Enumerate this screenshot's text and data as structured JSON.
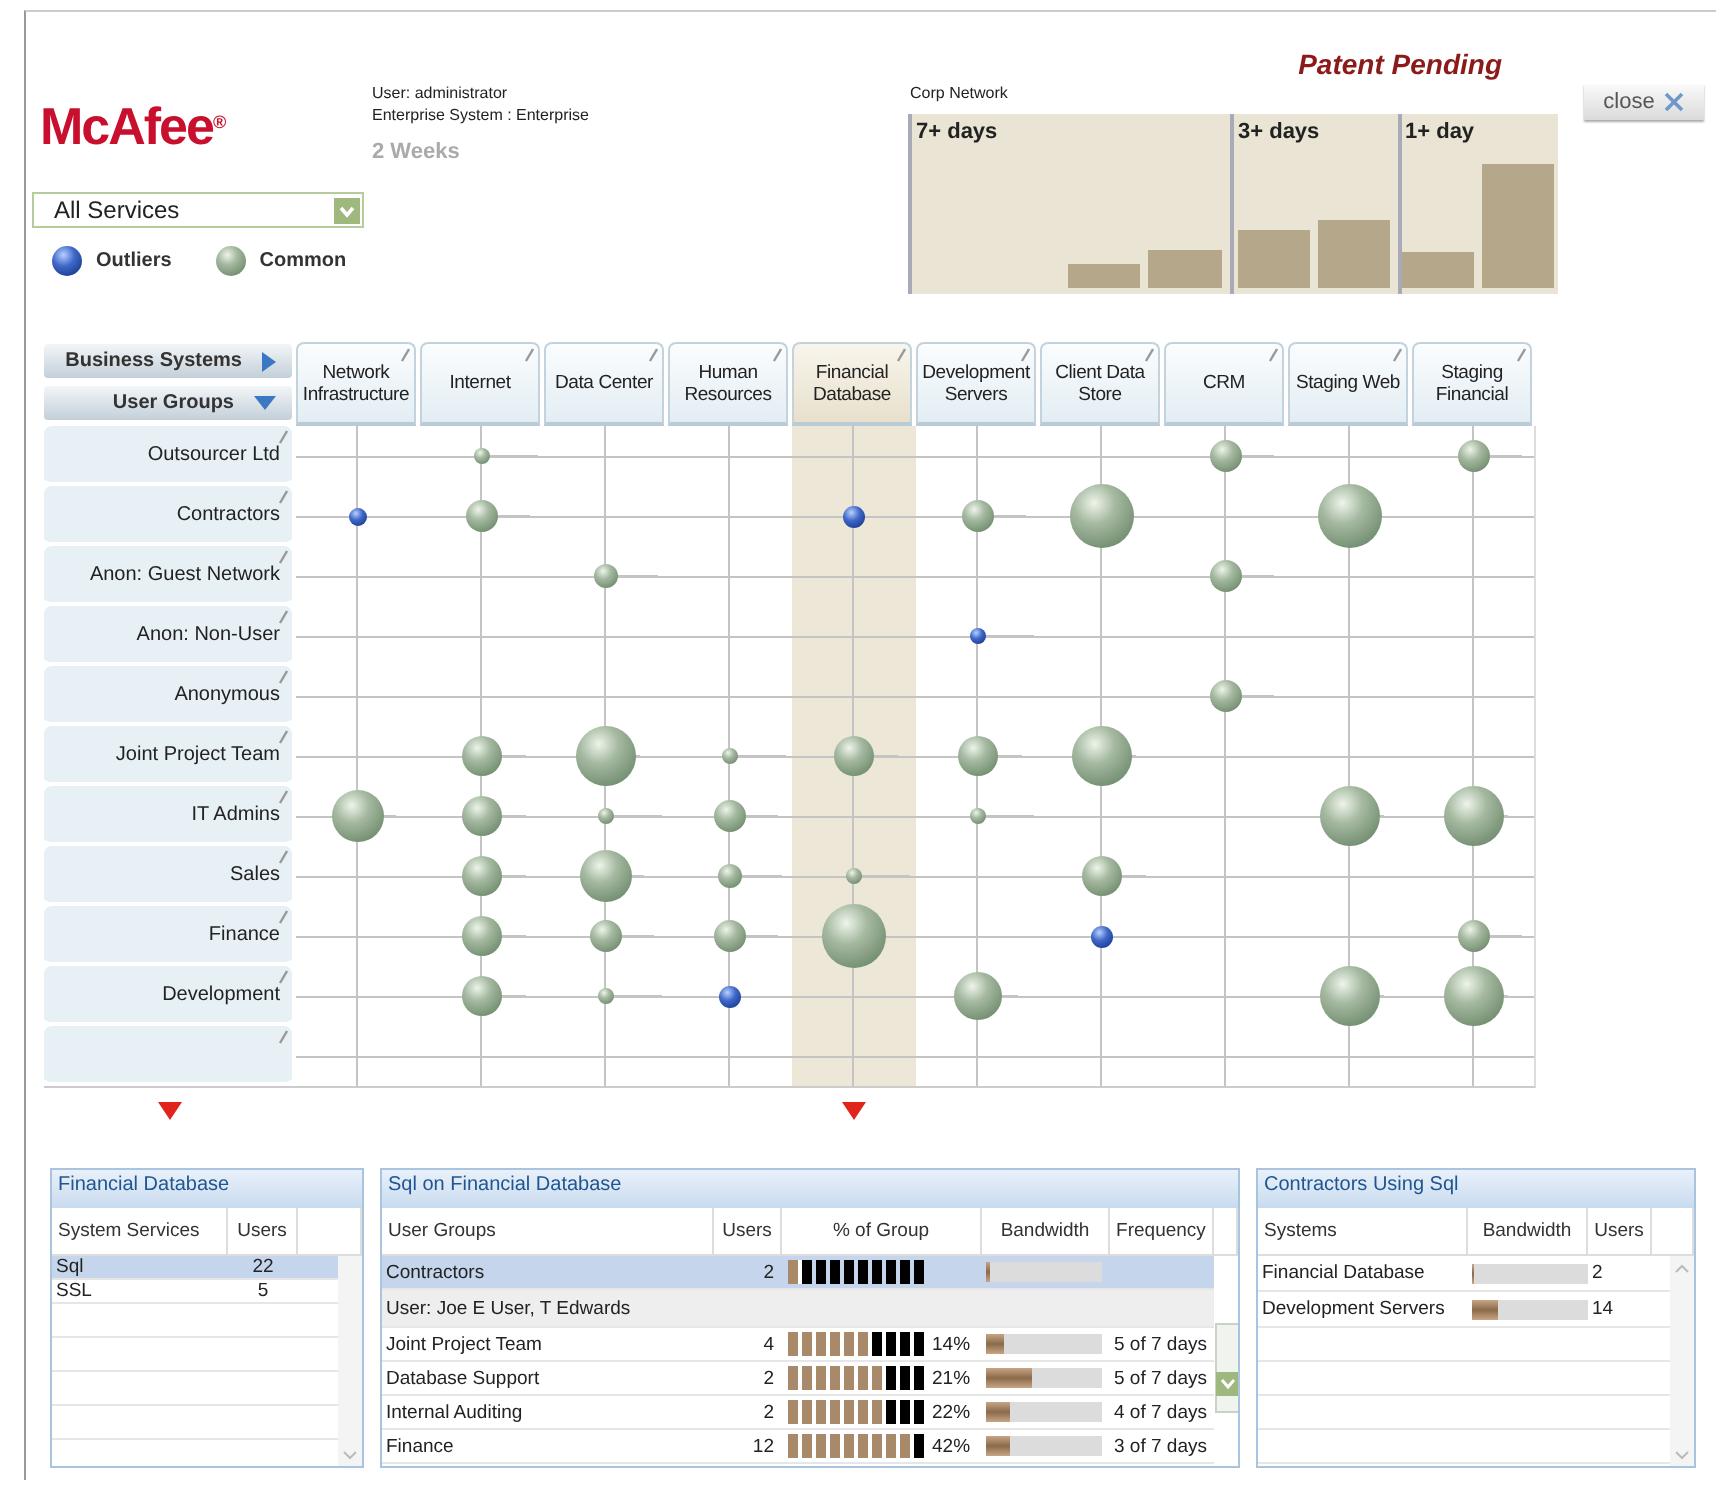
{
  "header": {
    "logo": "McAfee$^{®}$",
    "user": "User: administrator",
    "system": "Enterprise System : Enterprise",
    "period": "2 Weeks",
    "network": "Corp Network",
    "notice": "Patent Pending",
    "close": "close"
  },
  "service_filter": {
    "value": "All Services"
  },
  "legend": [
    {
      "kind": "outlier",
      "label": "Outliers"
    },
    {
      "kind": "common",
      "label": "Common"
    }
  ],
  "timeline": [
    {
      "label": "7+ days"
    },
    {
      "label": "3+ days"
    },
    {
      "label": "1+ day"
    }
  ],
  "matrix": {
    "axis_buttons": [
      {
        "label": "Business Systems",
        "kind": "right"
      },
      {
        "label": "User Groups",
        "kind": "down"
      }
    ],
    "columns": [
      {
        "label": "Network Infrastructure",
        "selected": false
      },
      {
        "label": "Internet",
        "selected": false
      },
      {
        "label": "Data Center",
        "selected": false
      },
      {
        "label": "Human Resources",
        "selected": false
      },
      {
        "label": "Financial Database",
        "selected": true
      },
      {
        "label": "Development Servers",
        "selected": false
      },
      {
        "label": "Client Data Store",
        "selected": false
      },
      {
        "label": "CRM",
        "selected": false
      },
      {
        "label": "Staging Web",
        "selected": false
      },
      {
        "label": "Staging Financial",
        "selected": false
      }
    ],
    "rows": [
      {
        "label": "Outsourcer Ltd",
        "cells": [
          null,
          {
            "kind": "common",
            "level": 0.25
          },
          null,
          null,
          null,
          null,
          null,
          {
            "kind": "common",
            "level": 0.5
          },
          null,
          {
            "kind": "common",
            "level": 0.5
          }
        ]
      },
      {
        "label": "Contractors",
        "cells": [
          {
            "kind": "outlier",
            "level": 0.28
          },
          {
            "kind": "common",
            "level": 0.5
          },
          null,
          null,
          {
            "kind": "outlier",
            "level": 0.34
          },
          {
            "kind": "common",
            "level": 0.5
          },
          {
            "kind": "common",
            "level": 1
          },
          null,
          {
            "kind": "common",
            "level": 1
          },
          null
        ]
      },
      {
        "label": "Anon: Guest Network",
        "cells": [
          null,
          null,
          {
            "kind": "common",
            "level": 0.38
          },
          null,
          null,
          null,
          null,
          {
            "kind": "common",
            "level": 0.5
          },
          null,
          null
        ]
      },
      {
        "label": "Anon: Non-User",
        "cells": [
          null,
          null,
          null,
          null,
          null,
          {
            "kind": "outlier",
            "level": 0.25
          },
          null,
          null,
          null,
          null
        ]
      },
      {
        "label": "Anonymous",
        "cells": [
          null,
          null,
          null,
          null,
          null,
          null,
          null,
          {
            "kind": "common",
            "level": 0.5
          },
          null,
          null
        ]
      },
      {
        "label": "Joint Project Team",
        "cells": [
          null,
          {
            "kind": "common",
            "level": 0.62
          },
          {
            "kind": "common",
            "level": 0.94
          },
          {
            "kind": "common",
            "level": 0.25
          },
          {
            "kind": "common",
            "level": 0.62
          },
          {
            "kind": "common",
            "level": 0.62
          },
          {
            "kind": "common",
            "level": 0.94
          },
          null,
          null,
          null
        ]
      },
      {
        "label": "IT Admins",
        "cells": [
          {
            "kind": "common",
            "level": 0.81
          },
          {
            "kind": "common",
            "level": 0.62
          },
          {
            "kind": "common",
            "level": 0.25
          },
          {
            "kind": "common",
            "level": 0.5
          },
          null,
          {
            "kind": "common",
            "level": 0.25
          },
          null,
          null,
          {
            "kind": "common",
            "level": 0.94
          },
          {
            "kind": "common",
            "level": 0.94
          }
        ]
      },
      {
        "label": "Sales",
        "cells": [
          null,
          {
            "kind": "common",
            "level": 0.62
          },
          {
            "kind": "common",
            "level": 0.81
          },
          {
            "kind": "common",
            "level": 0.38
          },
          {
            "kind": "common",
            "level": 0.25
          },
          null,
          {
            "kind": "common",
            "level": 0.62
          },
          null,
          null,
          null
        ]
      },
      {
        "label": "Finance",
        "cells": [
          null,
          {
            "kind": "common",
            "level": 0.62
          },
          {
            "kind": "common",
            "level": 0.5
          },
          {
            "kind": "common",
            "level": 0.5
          },
          {
            "kind": "common",
            "level": 1
          },
          null,
          {
            "kind": "outlier",
            "level": 0.34
          },
          null,
          null,
          {
            "kind": "common",
            "level": 0.5
          }
        ]
      },
      {
        "label": "Development",
        "cells": [
          null,
          {
            "kind": "common",
            "level": 0.62
          },
          {
            "kind": "common",
            "level": 0.25
          },
          {
            "kind": "outlier",
            "level": 0.34
          },
          null,
          {
            "kind": "common",
            "level": 0.75
          },
          null,
          null,
          {
            "kind": "common",
            "level": 0.94
          },
          {
            "kind": "common",
            "level": 0.94
          }
        ]
      },
      {
        "label": "",
        "cells": [
          null,
          null,
          null,
          null,
          null,
          null,
          null,
          null,
          null,
          null
        ]
      }
    ]
  },
  "services_panel": {
    "title": "Financial Database",
    "columns": [
      "System Services",
      "Users"
    ],
    "rows": [
      {
        "service": "Sql",
        "users": "22",
        "selected": true
      },
      {
        "service": "SSL",
        "users": "5",
        "selected": false
      }
    ]
  },
  "groups_panel": {
    "title": "Sql on Financial Database",
    "columns": [
      "User Groups",
      "Users",
      "% of Group",
      "Bandwidth",
      "Frequency"
    ],
    "rows": [
      {
        "kind": "group",
        "group": "Contractors",
        "users": "2",
        "share": {
          "level": 0.1
        },
        "bandwidth": {
          "level": 0.03
        },
        "selected": true
      },
      {
        "kind": "detail",
        "text": "User: Joe E User, T Edwards",
        "selected": false
      },
      {
        "kind": "group",
        "group": "Joint Project Team",
        "users": "4",
        "share": {
          "level": 0.6,
          "reading": "14%"
        },
        "bandwidth": {
          "level": 0.15
        },
        "frequency": "5 of 7 days",
        "selected": false
      },
      {
        "kind": "group",
        "group": "Database Support",
        "users": "2",
        "share": {
          "level": 0.7,
          "reading": "21%"
        },
        "bandwidth": {
          "level": 0.4
        },
        "frequency": "5 of 7 days",
        "selected": false
      },
      {
        "kind": "group",
        "group": "Internal Auditing",
        "users": "2",
        "share": {
          "level": 0.7,
          "reading": "22%"
        },
        "bandwidth": {
          "level": 0.2
        },
        "frequency": "4 of 7 days",
        "selected": false
      },
      {
        "kind": "group",
        "group": "Finance",
        "users": "12",
        "share": {
          "level": 0.9,
          "reading": "42%"
        },
        "bandwidth": {
          "level": 0.2
        },
        "frequency": "3 of 7 days",
        "selected": false
      }
    ]
  },
  "systems_panel": {
    "title": "Contractors Using Sql",
    "columns": [
      "Systems",
      "Bandwidth",
      "Users"
    ],
    "rows": [
      {
        "system": "Financial Database",
        "bandwidth": {
          "level": 0.02
        },
        "users": "2",
        "selected": false
      },
      {
        "system": "Development Servers",
        "bandwidth": {
          "level": 0.22
        },
        "users": "14",
        "selected": false
      }
    ]
  }
}
